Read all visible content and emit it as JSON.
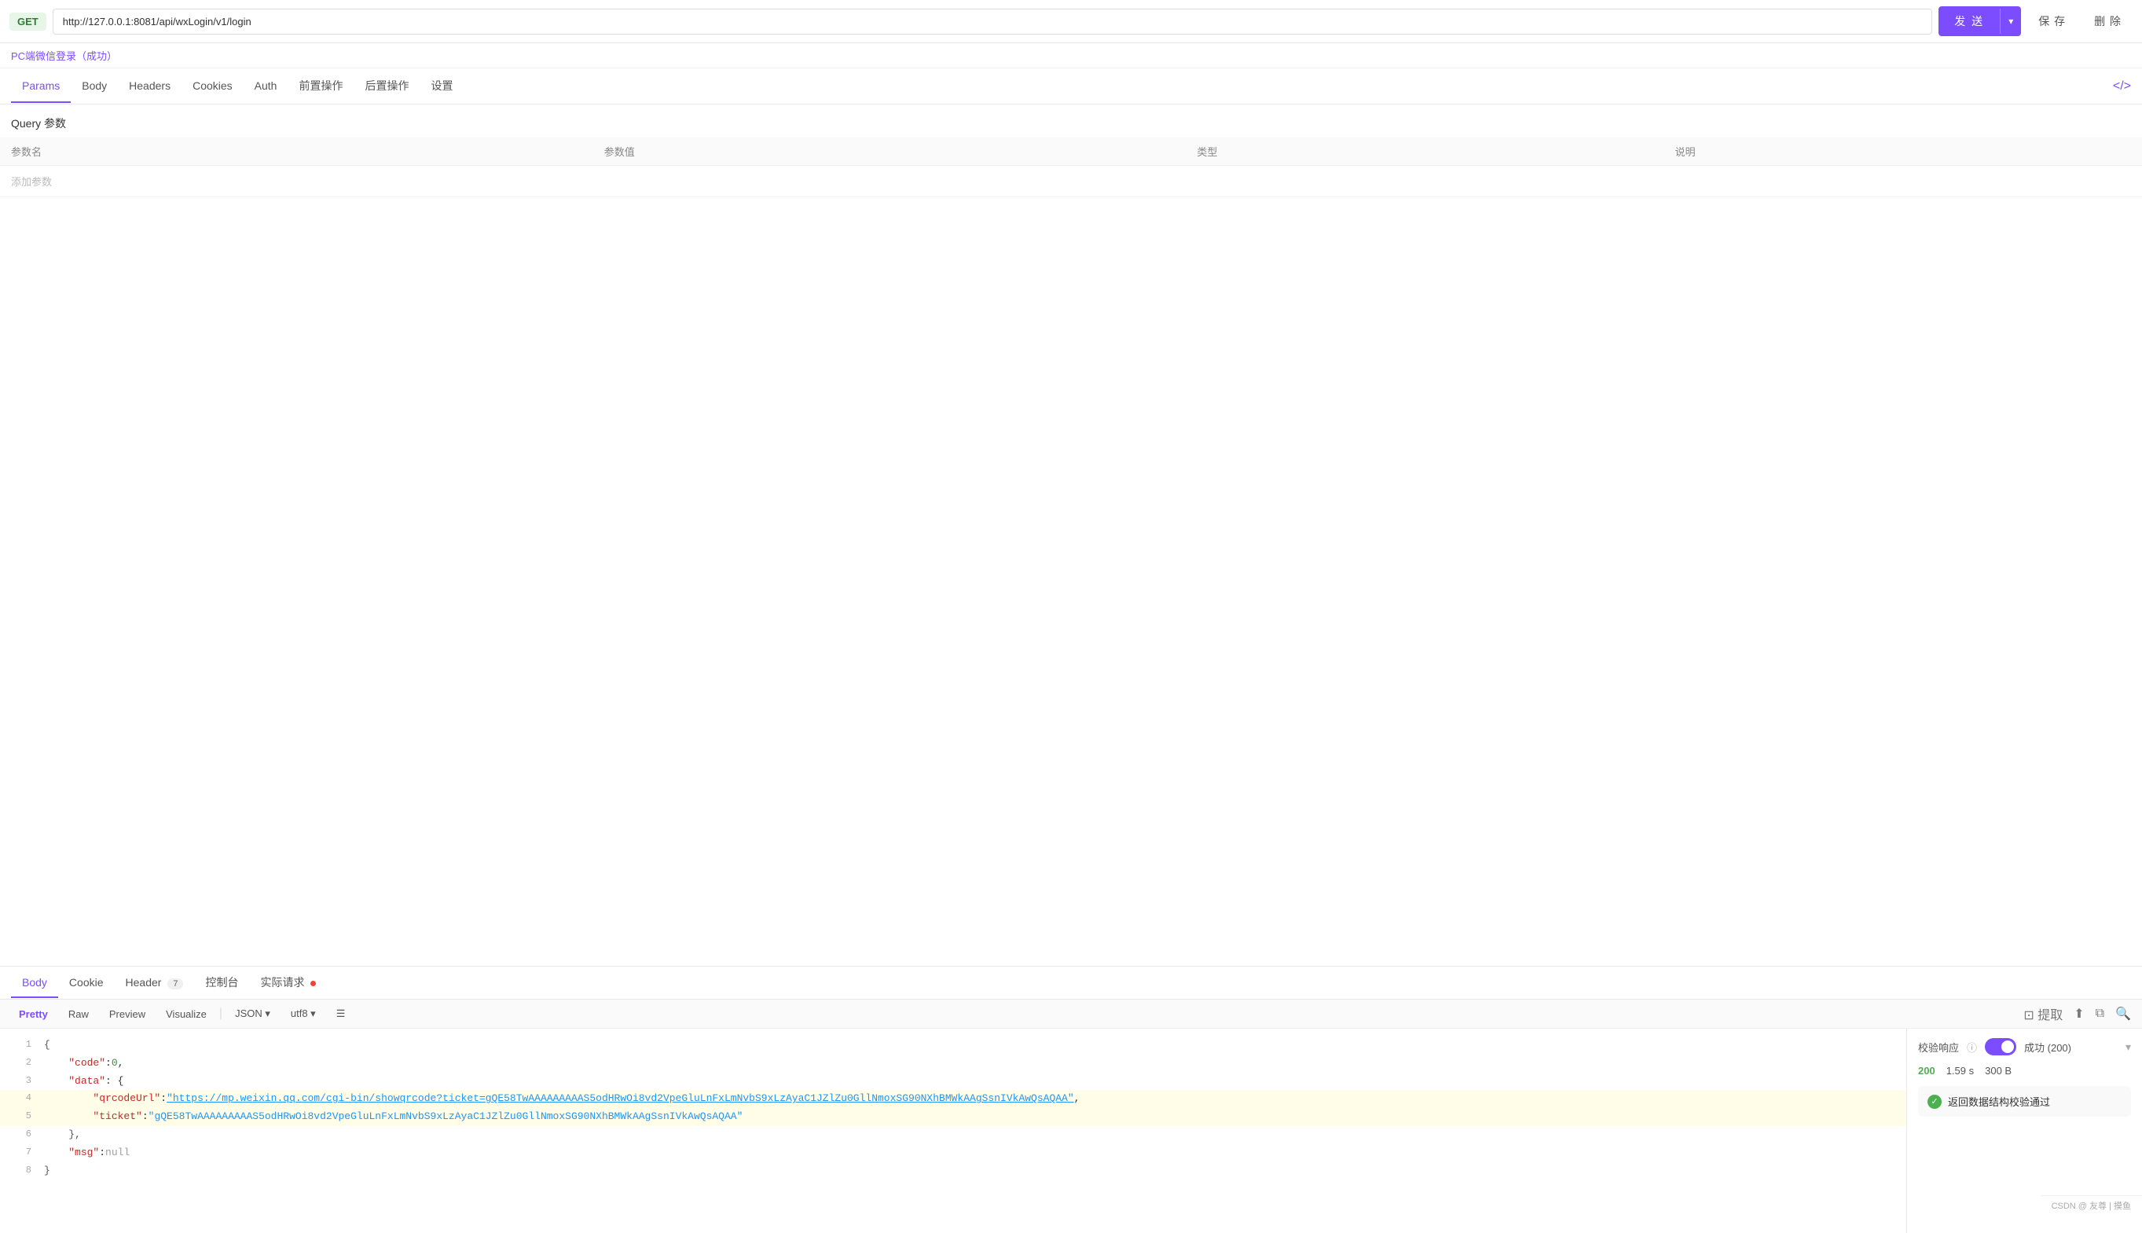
{
  "topbar": {
    "method": "GET",
    "url": "http://127.0.0.1:8081/api/wxLogin/v1/login",
    "send_label": "发 送",
    "save_label": "保 存",
    "delete_label": "删 除"
  },
  "subtitle": "PC端微信登录（成功）",
  "tabs": [
    {
      "id": "params",
      "label": "Params",
      "active": true
    },
    {
      "id": "body",
      "label": "Body",
      "active": false
    },
    {
      "id": "headers",
      "label": "Headers",
      "active": false
    },
    {
      "id": "cookies",
      "label": "Cookies",
      "active": false
    },
    {
      "id": "auth",
      "label": "Auth",
      "active": false
    },
    {
      "id": "pre-op",
      "label": "前置操作",
      "active": false
    },
    {
      "id": "post-op",
      "label": "后置操作",
      "active": false
    },
    {
      "id": "settings",
      "label": "设置",
      "active": false
    }
  ],
  "query_section": {
    "title": "Query 参数",
    "columns": [
      "参数名",
      "参数值",
      "类型",
      "说明"
    ],
    "add_placeholder": "添加参数"
  },
  "response": {
    "tabs": [
      {
        "id": "body",
        "label": "Body",
        "active": true
      },
      {
        "id": "cookie",
        "label": "Cookie",
        "active": false
      },
      {
        "id": "header",
        "label": "Header",
        "badge": "7",
        "active": false
      },
      {
        "id": "console",
        "label": "控制台",
        "active": false
      },
      {
        "id": "actual",
        "label": "实际请求",
        "dot": true,
        "active": false
      }
    ],
    "format_btns": [
      "Pretty",
      "Raw",
      "Preview",
      "Visualize"
    ],
    "active_format": "Pretty",
    "format_type": "JSON",
    "encoding": "utf8",
    "status_code": "200",
    "time": "1.59 s",
    "size": "300 B",
    "validate_label": "校验响应",
    "validate_status": "成功 (200)",
    "validation_msg": "返回数据结构校验通过",
    "json_lines": [
      {
        "num": 1,
        "content": "{",
        "type": "brace"
      },
      {
        "num": 2,
        "content": "\"code\": 0,",
        "type": "key-num",
        "key": "\"code\"",
        "colon": ": ",
        "value": "0",
        "comma": ","
      },
      {
        "num": 3,
        "content": "\"data\": {",
        "type": "key-brace",
        "key": "\"data\"",
        "colon": ": ",
        "value": "{"
      },
      {
        "num": 4,
        "content": "\"qrcodeUrl\": \"https://mp.weixin.qq.com/cgi-bin/showqrcode?ticket=gQE58TwAAAAAAAAAS5odHRwOi8vd2VpeGluLnFxLmNvbS9xLzAyaC1JZlZu0GllNmoxSG90NXhBMWkAAgSsnIVkAwQsAQAA\",",
        "type": "key-link",
        "key": "\"qrcodeUrl\"",
        "link": "https://mp.weixin.qq.com/cgi-bin/showqrcode?ticket=gQE58TwAAAAAAAAAS5odHRwOi8vd2VpeGluLnFxLmNvbS9xLzAyaC1JZlZu0GllNmoxSG90NXhBMWkAAgSsnIVkAwQsAQAA",
        "highlighted": true
      },
      {
        "num": 5,
        "content": "\"ticket\": \"gQE58TwAAAAAAAAAS5odHRwOi8vd2VpeGluLnFxLmNvbS9xLzAyaC1JZlZu0GllNmoxSG90NXhBMWkAAgSsnIVkAwQsAQAA\"",
        "type": "key-str",
        "key": "\"ticket\"",
        "value": "\"gQE58TwAAAAAAAAAS5odHRwOi8vd2VpeGluLnFxLmNvbS9xLzAyaC1JZlZu0GllNmoxSG90NXhBMWkAAgSsnIVkAwQsAQAA\"",
        "highlighted": true
      },
      {
        "num": 6,
        "content": "},",
        "type": "brace-comma"
      },
      {
        "num": 7,
        "content": "\"msg\": null",
        "type": "key-null",
        "key": "\"msg\"",
        "value": "null"
      },
      {
        "num": 8,
        "content": "}",
        "type": "brace"
      }
    ]
  },
  "footer": {
    "text": "CSDN @ 友尊 | 摸鱼"
  }
}
